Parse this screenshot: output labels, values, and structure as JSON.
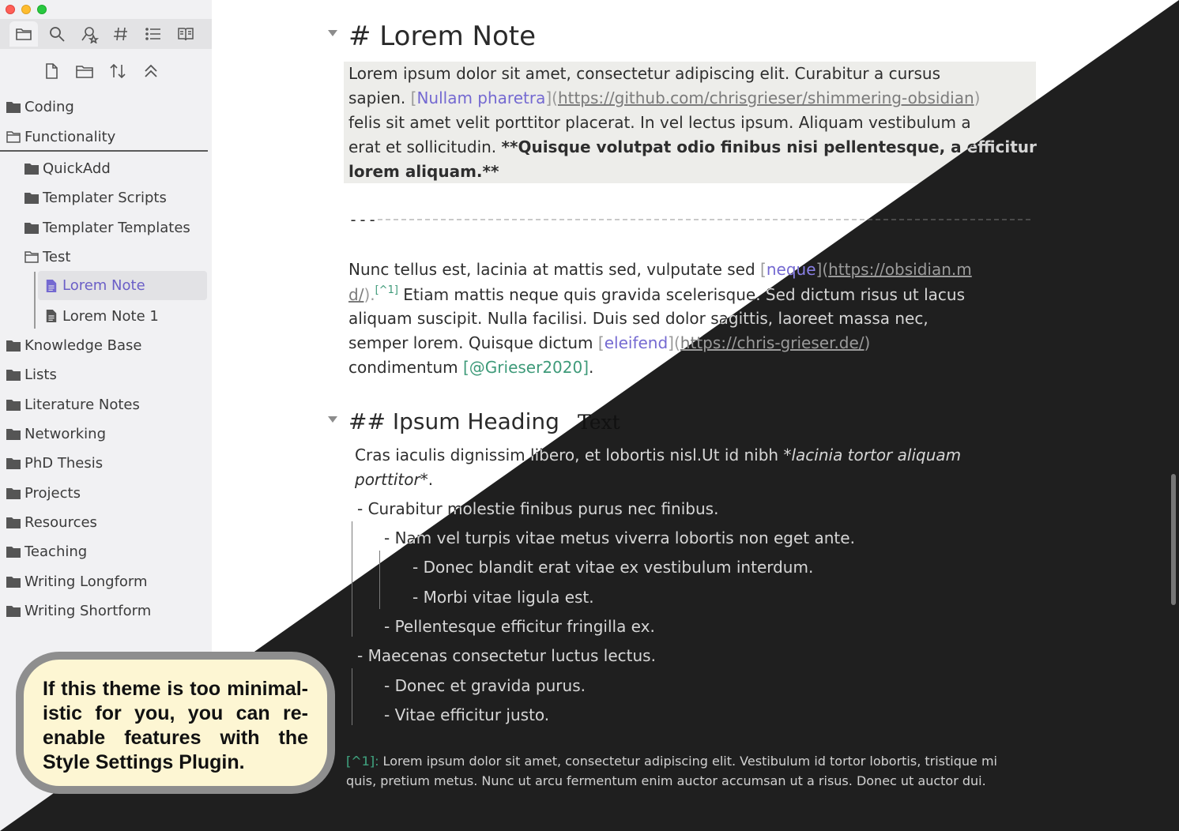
{
  "window": {
    "title": "Lorem Note"
  },
  "sidebar": {
    "tabs": [
      {
        "icon": "folder-icon",
        "label": "Files"
      },
      {
        "icon": "search-icon",
        "label": "Search"
      },
      {
        "icon": "starred-search-icon",
        "label": "Search favorites"
      },
      {
        "icon": "hashtag-icon",
        "label": "Tags"
      },
      {
        "icon": "list-icon",
        "label": "Outline"
      },
      {
        "icon": "book-icon",
        "label": "Reading"
      }
    ],
    "actions": [
      "new-note-icon",
      "new-folder-icon",
      "sort-icon",
      "collapse-all-icon"
    ],
    "folders": [
      "Coding",
      "Functionality",
      "QuickAdd",
      "Templater Scripts",
      "Templater Templates",
      "Test",
      "Lorem Note",
      "Lorem Note 1",
      "Knowledge Base",
      "Lists",
      "Literature Notes",
      "Networking",
      "PhD Thesis",
      "Projects",
      "Resources",
      "Teaching",
      "Writing Longform",
      "Writing Shortform"
    ]
  },
  "editor": {
    "h1": "# Lorem Note",
    "quote": {
      "l1": "Lorem ipsum dolor sit amet, consectetur adipiscing elit. Curabitur a cursus",
      "l2_a": "sapien. ",
      "l2_open": "[",
      "l2_link": "Nullam pharetra",
      "l2_close": "](",
      "l2_url": "https://github.com/chrisgrieser/shimmering-obsidian",
      "l2_end": ")",
      "l3": "felis sit amet velit porttitor placerat. In vel lectus ipsum. Aliquam vestibulum a",
      "l4_a": "erat et sollicitudin. ",
      "l4_bold": "**Quisque volutpat odio finibus nisi pellentesque, a efficitur",
      "l5_bold": "lorem aliquam.**"
    },
    "hr": "---",
    "para": {
      "l1_a": "Nunc tellus est, lacinia at mattis sed, vulputate sed ",
      "l1_open": "[",
      "l1_link": "neque",
      "l1_close": "](",
      "l1_url": "https://obsidian.m",
      "l2_url": "d/",
      "l2_b": ").",
      "l2_fn": "[^1]",
      "l2_c": " Etiam mattis neque quis gravida scelerisque. Sed dictum risus ut lacus",
      "l3": "aliquam suscipit. Nulla facilisi. Duis sed dolor sagittis, laoreet massa nec,",
      "l4_a": "semper lorem. Quisque dictum ",
      "l4_open": "[",
      "l4_link": "eleifend",
      "l4_close": "](",
      "l4_url": "https://chris-grieser.de/",
      "l4_end": ")",
      "l5_a": "condimentum ",
      "l5_cite": "[@Grieser2020]",
      "l5_end": "."
    },
    "h2": "## Ipsum Heading",
    "h2_overlay": "Text",
    "para2": {
      "l1_a": "Cras iaculis dignissim libero, et lobortis nisl.Ut id nibh ",
      "l1_ital": "*lacinia tortor aliquam",
      "l2_ital": "porttitor*",
      "l2_end": "."
    },
    "list": [
      "- Curabitur molestie finibus purus nec finibus.",
      "- Nam vel turpis vitae metus viverra lobortis non eget ante.",
      "- Donec blandit erat vitae ex vestibulum interdum.",
      "- Morbi vitae ligula est.",
      "- Pellentesque efficitur fringilla ex.",
      "- Maecenas consectetur luctus lectus.",
      "- Donec et gravida purus.",
      "- Vitae efficitur justo."
    ],
    "footnote": {
      "label": "[^1]:",
      "l1": " Lorem ipsum dolor sit amet, consectetur adipiscing elit. Vestibulum id tortor lobortis, tristique mi",
      "l2": "quis, pretium metus. Nunc ut arcu fermentum enim auctor accumsan ut a risus. Donec ut auctor dui."
    }
  },
  "callout": {
    "text": "If this theme is too minimal-istic for you, you can re-enable features with the Style Settings Plugin."
  },
  "colors": {
    "accent": "#6b5fc7",
    "dark_bg": "#1f1f1f",
    "callout_bg": "#fdf6d3"
  }
}
